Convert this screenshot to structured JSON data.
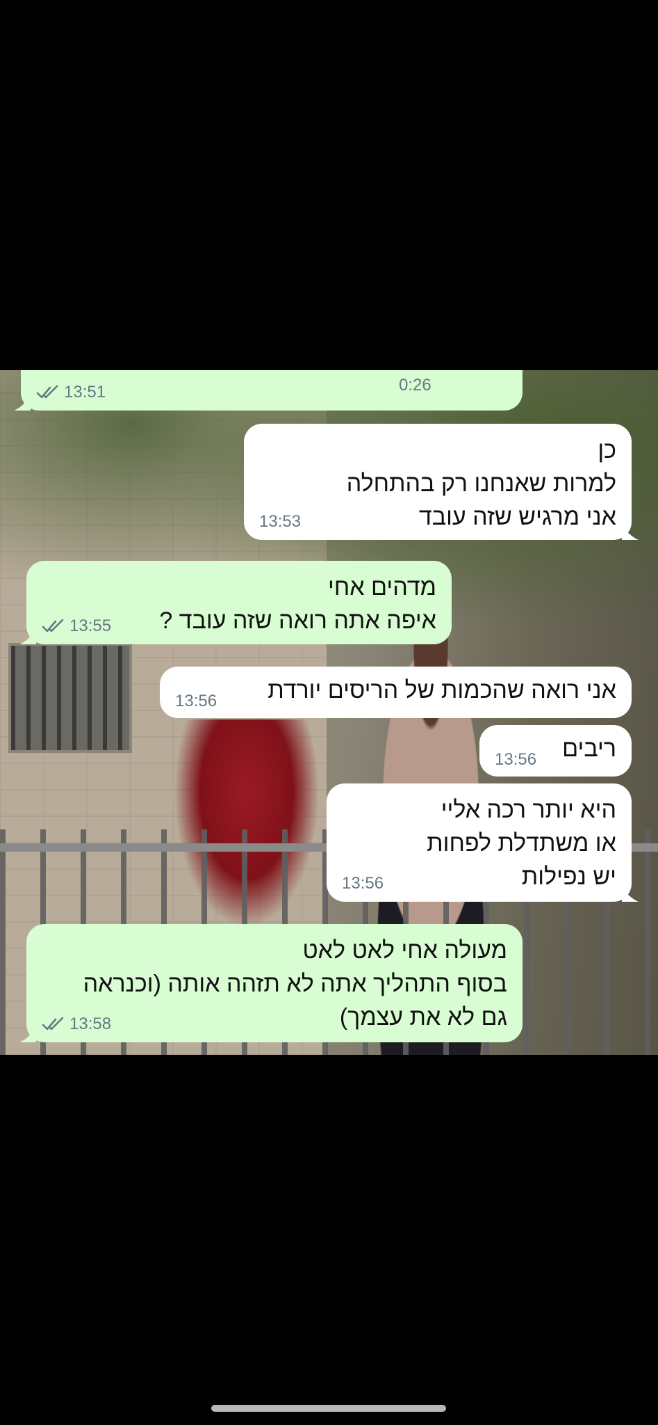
{
  "colors": {
    "outgoing_bubble": "#d9fdd3",
    "incoming_bubble": "#ffffff",
    "timestamp": "#667781",
    "read_ticks": "#667781",
    "background": "#000000"
  },
  "messages": [
    {
      "direction": "outgoing",
      "type": "voice",
      "duration": "0:26",
      "time": "13:51",
      "status_icon": "double-check-icon"
    },
    {
      "direction": "incoming",
      "type": "text",
      "text": "כן\nלמרות שאנחנו רק בהתחלה\nאני מרגיש שזה עובד",
      "time": "13:53"
    },
    {
      "direction": "outgoing",
      "type": "text",
      "text": "מדהים אחי\nאיפה אתה רואה שזה עובד ?",
      "time": "13:55",
      "status_icon": "double-check-icon"
    },
    {
      "direction": "incoming",
      "type": "text",
      "text": "אני רואה שהכמות של הריסים יורדת",
      "time": "13:56"
    },
    {
      "direction": "incoming",
      "type": "text",
      "text": "ריבים",
      "time": "13:56"
    },
    {
      "direction": "incoming",
      "type": "text",
      "text": "היא יותר רכה אליי\nאו משתדלת לפחות\nיש נפילות",
      "time": "13:56"
    },
    {
      "direction": "outgoing",
      "type": "text",
      "text": "מעולה אחי לאט לאט\nבסוף התהליך אתה לא תזהה אותה (וכנראה\nגם לא את עצמך)",
      "time": "13:58",
      "status_icon": "double-check-icon"
    }
  ]
}
